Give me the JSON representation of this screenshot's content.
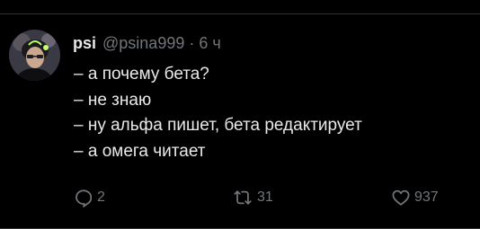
{
  "colors": {
    "background": "#000000",
    "text_primary": "#e7e9ea",
    "text_secondary": "#71767b",
    "divider": "#2f3336"
  },
  "author": {
    "display_name": "psi",
    "handle": "@psina999",
    "separator": "·",
    "time": "6 ч",
    "avatar_icon": "profile-avatar"
  },
  "tweet": {
    "lines": [
      "– а почему бета?",
      "– не знаю",
      "– ну альфа пишет, бета редактирует",
      "– а омега читает"
    ]
  },
  "actions": {
    "reply": {
      "icon": "reply-icon",
      "count": "2"
    },
    "retweet": {
      "icon": "retweet-icon",
      "count": "31"
    },
    "like": {
      "icon": "heart-icon",
      "count": "937"
    }
  }
}
